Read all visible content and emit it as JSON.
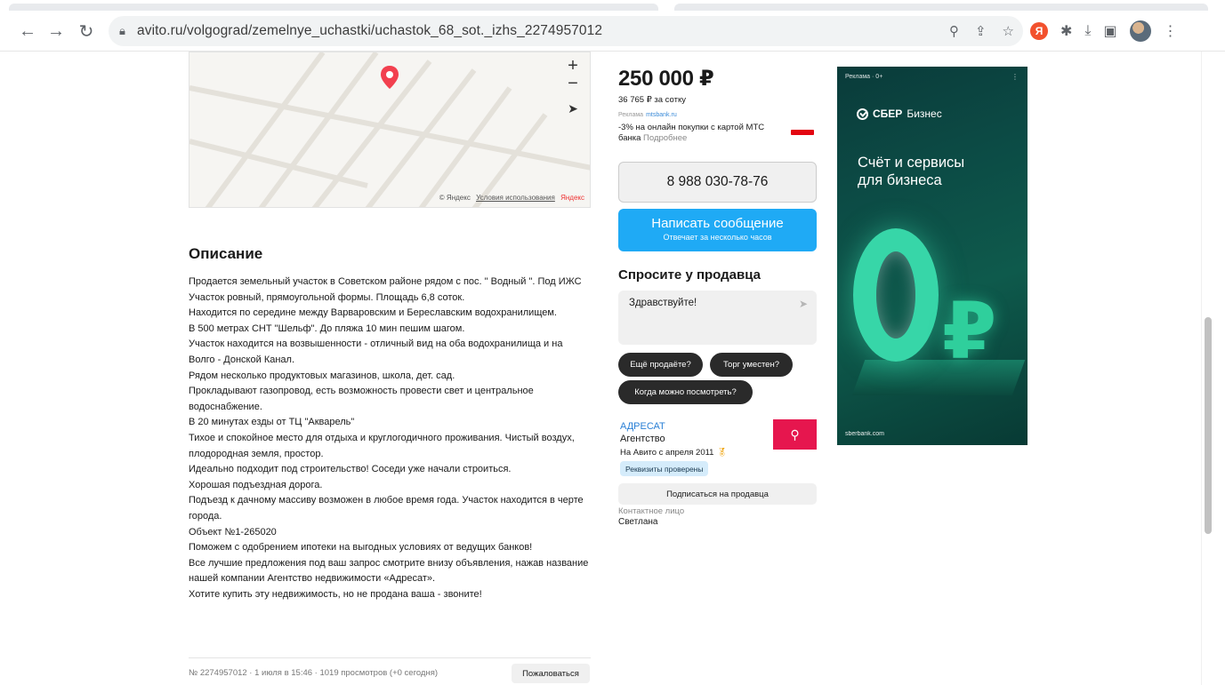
{
  "browser": {
    "url": "avito.ru/volgograd/zemelnye_uchastki/uchastok_68_sot._izhs_2274957012"
  },
  "map": {
    "attribution_brand": "© Яндекс",
    "attribution_link": "Условия использования",
    "attribution_logo": "Яндекс"
  },
  "description": {
    "title": "Описание",
    "lines": [
      "Продается земельный участок в Советском районе рядом с пос. \" Водный \". Под ИЖС",
      "Участок ровный, прямоугольной формы. Площадь 6,8 соток.",
      "Находится по середине между Варваровским и Береславским водохранилищем.",
      "В 500 метрах СНТ \"Шельф\". До пляжа 10 мин пешим шагом.",
      "Участок находится на возвышенности - отличный вид на оба водохранилища и на Волго - Донской Канал.",
      "Рядом несколько продуктовых магазинов, школа, дет. сад.",
      "Прокладывают газопровод, есть возможность провести свет и центральное водоснабжение.",
      "В 20 минутах езды от ТЦ \"Акварель\"",
      "Тихое и спокойное место для отдыха и круглогодичного проживания. Чистый воздух, плодородная земля, простор.",
      "Идеально подходит под строительство! Соседи уже начали строиться.",
      "Хорошая подъездная дорога.",
      "Подъезд к дачному массиву возможен в любое время года. Участок находится в черте города.",
      "Объект №1-265020",
      "Поможем с одобрением ипотеки на выгодных условиях от ведущих банков!",
      "Все лучшие предложения под ваш запрос смотрите внизу объявления, нажав название нашей компании Агентство недвижимости «Адресат».",
      "Хотите купить эту недвижимость, но не продана ваша - звоните!"
    ]
  },
  "footer": {
    "meta": "№ 2274957012 · 1 июля в 15:46 · 1019 просмотров (+0 сегодня)",
    "report_label": "Пожаловаться"
  },
  "listing": {
    "price": "250 000 ₽",
    "price_per_unit": "36 765 ₽ за сотку",
    "promo_label": "Реклама",
    "promo_domain": "mtsbank.ru",
    "promo_text": "-3% на онлайн покупки с картой МТС банка",
    "promo_more": "Подробнее",
    "phone": "8 988 030-78-76",
    "message_button": "Написать сообщение",
    "message_sub": "Отвечает за несколько часов"
  },
  "ask": {
    "title": "Спросите у продавца",
    "input_value": "Здравствуйте!",
    "chips": [
      "Ещё продаёте?",
      "Торг уместен?",
      "Когда можно посмотреть?"
    ]
  },
  "seller": {
    "name": "АДРЕСАТ",
    "type": "Агентство",
    "since": "На Авито с апреля 2011",
    "verified": "Реквизиты проверены",
    "subscribe": "Подписаться на продавца",
    "contact_label": "Контактное лицо",
    "contact_name": "Светлана"
  },
  "ad": {
    "label": "Реклама · 0+",
    "brand": "СБЕР",
    "brand_suffix": "Бизнес",
    "headline_1": "Счёт и сервисы",
    "headline_2": "для бизнеса",
    "domain": "sberbank.com"
  },
  "colors": {
    "accent_blue": "#1faaf5",
    "ad_green": "#37d6a8",
    "seller_logo": "#e6164e"
  }
}
